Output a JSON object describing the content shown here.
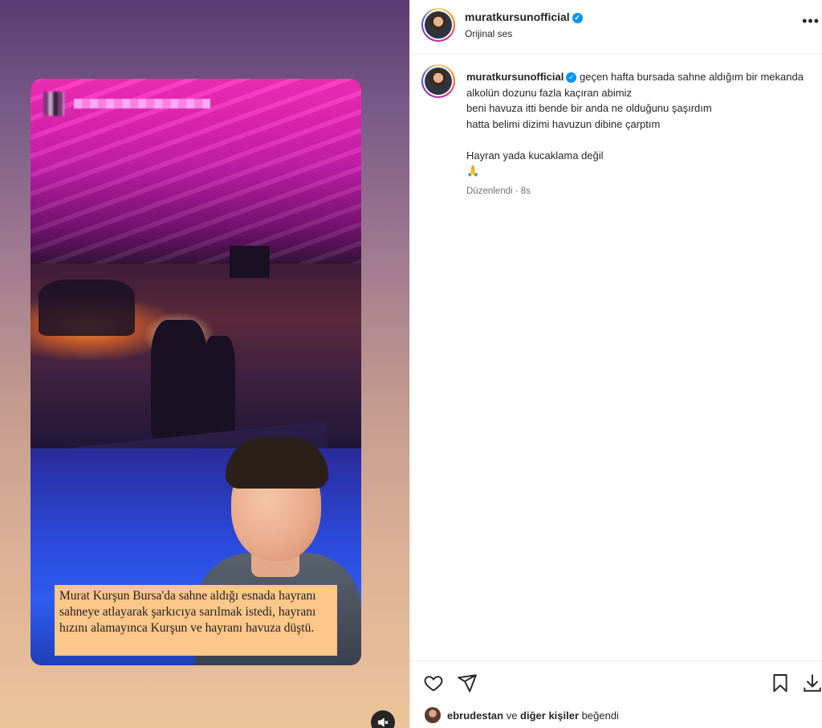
{
  "post": {
    "username": "muratkursunofficial",
    "audio_label": "Orijinal ses",
    "more_label": "•••"
  },
  "media": {
    "caption_overlay": "Murat Kurşun Bursa'da sahne aldığı esnada hayranı sahneye atlayarak şarkıcıya sarılmak istedi, hayranı hızını alamayınca Kurşun ve hayranı havuza düştü.",
    "mute_icon": "speaker-muted-icon"
  },
  "comment": {
    "username": "muratkursunofficial",
    "first_line": "geçen hafta bursada sahne aldığım bir mekanda",
    "lines": [
      "alkolün dozunu fazla kaçıran abimiz",
      "beni havuza itti bende bir anda ne olduğunu şaşırdım",
      "hatta belimi dizimi havuzun dibine çarptım",
      "",
      "Hayran yada kucaklama değil"
    ],
    "emoji": "🙏",
    "meta": "Düzenlendi · 8s"
  },
  "actions": {
    "icons": [
      "heart-icon",
      "share-icon",
      "bookmark-icon",
      "download-icon"
    ]
  },
  "likes": {
    "first_user": "ebrudestan",
    "connector": " ve ",
    "others": "diğer kişiler",
    "suffix": " beğendi"
  },
  "colors": {
    "verified": "#0095f6",
    "caption_bg": "#fbc78a",
    "text": "#262626",
    "secondary": "#737373"
  }
}
